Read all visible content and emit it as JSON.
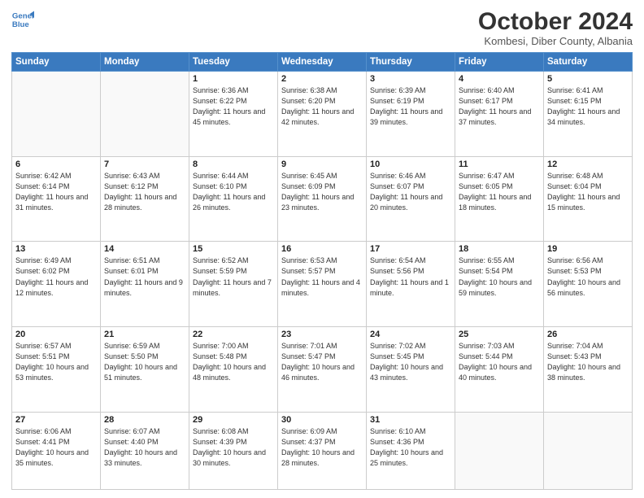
{
  "header": {
    "logo_line1": "General",
    "logo_line2": "Blue",
    "month": "October 2024",
    "location": "Kombesi, Diber County, Albania"
  },
  "weekdays": [
    "Sunday",
    "Monday",
    "Tuesday",
    "Wednesday",
    "Thursday",
    "Friday",
    "Saturday"
  ],
  "weeks": [
    [
      {
        "day": null
      },
      {
        "day": null
      },
      {
        "day": "1",
        "sunrise": "6:36 AM",
        "sunset": "6:22 PM",
        "daylight": "11 hours and 45 minutes."
      },
      {
        "day": "2",
        "sunrise": "6:38 AM",
        "sunset": "6:20 PM",
        "daylight": "11 hours and 42 minutes."
      },
      {
        "day": "3",
        "sunrise": "6:39 AM",
        "sunset": "6:19 PM",
        "daylight": "11 hours and 39 minutes."
      },
      {
        "day": "4",
        "sunrise": "6:40 AM",
        "sunset": "6:17 PM",
        "daylight": "11 hours and 37 minutes."
      },
      {
        "day": "5",
        "sunrise": "6:41 AM",
        "sunset": "6:15 PM",
        "daylight": "11 hours and 34 minutes."
      }
    ],
    [
      {
        "day": "6",
        "sunrise": "6:42 AM",
        "sunset": "6:14 PM",
        "daylight": "11 hours and 31 minutes."
      },
      {
        "day": "7",
        "sunrise": "6:43 AM",
        "sunset": "6:12 PM",
        "daylight": "11 hours and 28 minutes."
      },
      {
        "day": "8",
        "sunrise": "6:44 AM",
        "sunset": "6:10 PM",
        "daylight": "11 hours and 26 minutes."
      },
      {
        "day": "9",
        "sunrise": "6:45 AM",
        "sunset": "6:09 PM",
        "daylight": "11 hours and 23 minutes."
      },
      {
        "day": "10",
        "sunrise": "6:46 AM",
        "sunset": "6:07 PM",
        "daylight": "11 hours and 20 minutes."
      },
      {
        "day": "11",
        "sunrise": "6:47 AM",
        "sunset": "6:05 PM",
        "daylight": "11 hours and 18 minutes."
      },
      {
        "day": "12",
        "sunrise": "6:48 AM",
        "sunset": "6:04 PM",
        "daylight": "11 hours and 15 minutes."
      }
    ],
    [
      {
        "day": "13",
        "sunrise": "6:49 AM",
        "sunset": "6:02 PM",
        "daylight": "11 hours and 12 minutes."
      },
      {
        "day": "14",
        "sunrise": "6:51 AM",
        "sunset": "6:01 PM",
        "daylight": "11 hours and 9 minutes."
      },
      {
        "day": "15",
        "sunrise": "6:52 AM",
        "sunset": "5:59 PM",
        "daylight": "11 hours and 7 minutes."
      },
      {
        "day": "16",
        "sunrise": "6:53 AM",
        "sunset": "5:57 PM",
        "daylight": "11 hours and 4 minutes."
      },
      {
        "day": "17",
        "sunrise": "6:54 AM",
        "sunset": "5:56 PM",
        "daylight": "11 hours and 1 minute."
      },
      {
        "day": "18",
        "sunrise": "6:55 AM",
        "sunset": "5:54 PM",
        "daylight": "10 hours and 59 minutes."
      },
      {
        "day": "19",
        "sunrise": "6:56 AM",
        "sunset": "5:53 PM",
        "daylight": "10 hours and 56 minutes."
      }
    ],
    [
      {
        "day": "20",
        "sunrise": "6:57 AM",
        "sunset": "5:51 PM",
        "daylight": "10 hours and 53 minutes."
      },
      {
        "day": "21",
        "sunrise": "6:59 AM",
        "sunset": "5:50 PM",
        "daylight": "10 hours and 51 minutes."
      },
      {
        "day": "22",
        "sunrise": "7:00 AM",
        "sunset": "5:48 PM",
        "daylight": "10 hours and 48 minutes."
      },
      {
        "day": "23",
        "sunrise": "7:01 AM",
        "sunset": "5:47 PM",
        "daylight": "10 hours and 46 minutes."
      },
      {
        "day": "24",
        "sunrise": "7:02 AM",
        "sunset": "5:45 PM",
        "daylight": "10 hours and 43 minutes."
      },
      {
        "day": "25",
        "sunrise": "7:03 AM",
        "sunset": "5:44 PM",
        "daylight": "10 hours and 40 minutes."
      },
      {
        "day": "26",
        "sunrise": "7:04 AM",
        "sunset": "5:43 PM",
        "daylight": "10 hours and 38 minutes."
      }
    ],
    [
      {
        "day": "27",
        "sunrise": "6:06 AM",
        "sunset": "4:41 PM",
        "daylight": "10 hours and 35 minutes."
      },
      {
        "day": "28",
        "sunrise": "6:07 AM",
        "sunset": "4:40 PM",
        "daylight": "10 hours and 33 minutes."
      },
      {
        "day": "29",
        "sunrise": "6:08 AM",
        "sunset": "4:39 PM",
        "daylight": "10 hours and 30 minutes."
      },
      {
        "day": "30",
        "sunrise": "6:09 AM",
        "sunset": "4:37 PM",
        "daylight": "10 hours and 28 minutes."
      },
      {
        "day": "31",
        "sunrise": "6:10 AM",
        "sunset": "4:36 PM",
        "daylight": "10 hours and 25 minutes."
      },
      {
        "day": null
      },
      {
        "day": null
      }
    ]
  ]
}
